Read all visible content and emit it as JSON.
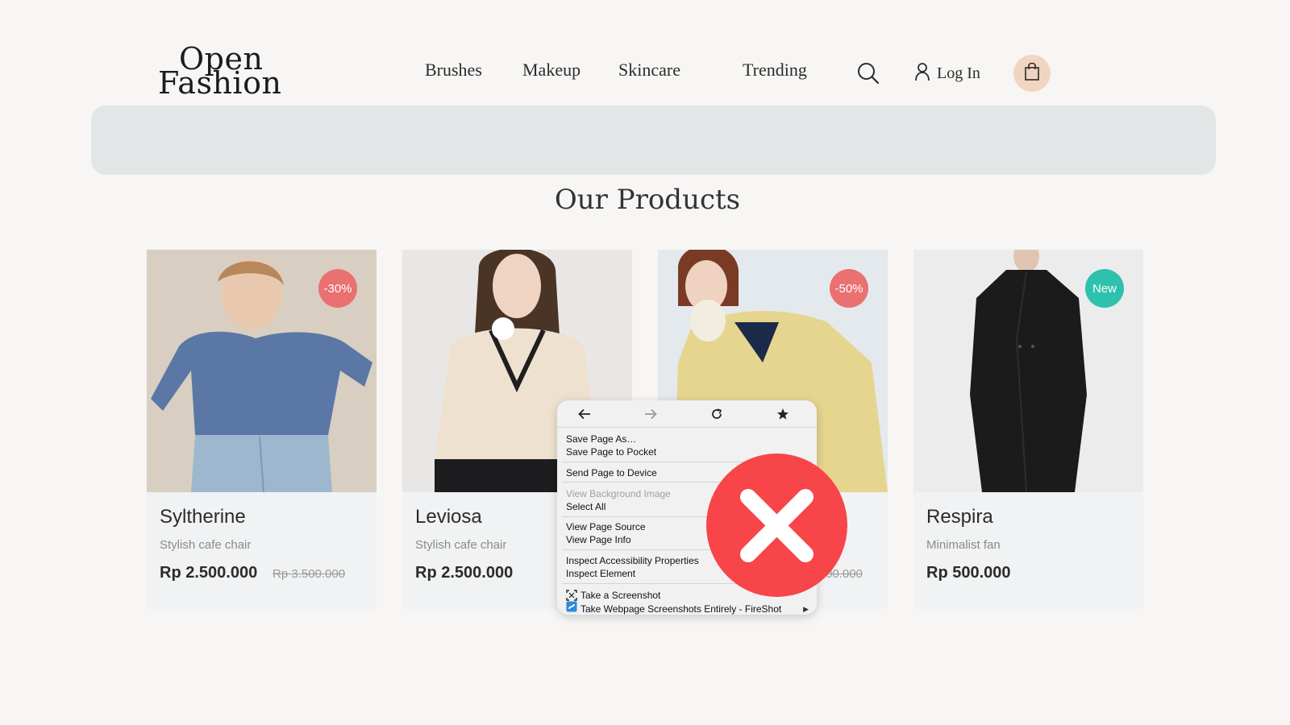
{
  "brand": {
    "line1": "Open",
    "line2": "Fashion"
  },
  "nav": [
    {
      "label": "Brushes"
    },
    {
      "label": "Makeup"
    },
    {
      "label": "Skincare"
    },
    {
      "label": "Trending"
    }
  ],
  "header": {
    "search_icon": "search-icon",
    "login_label": "Log In",
    "user_icon": "user-icon",
    "cart_icon": "shopping-bag-icon"
  },
  "section": {
    "title": "Our Products"
  },
  "products": [
    {
      "name": "Syltherine",
      "desc": "Stylish cafe chair",
      "price": "Rp 2.500.000",
      "old_price": "Rp 3.500.000",
      "badge": "-30%",
      "badge_color": "#e97171"
    },
    {
      "name": "Leviosa",
      "desc": "Stylish cafe chair",
      "price": "Rp 2.500.000",
      "old_price": "",
      "badge": "",
      "badge_color": ""
    },
    {
      "name": "",
      "desc": "",
      "price": "",
      "old_price": "00.000",
      "badge": "-50%",
      "badge_color": "#e97171"
    },
    {
      "name": "Respira",
      "desc": "Minimalist fan",
      "price": "Rp 500.000",
      "old_price": "",
      "badge": "New",
      "badge_color": "#2ec1ac"
    }
  ],
  "context_menu": {
    "toolbar": [
      "back-arrow-icon",
      "forward-arrow-icon",
      "reload-icon",
      "bookmark-star-icon"
    ],
    "items": {
      "save_as": "Save Page As…",
      "save_pocket": "Save Page to Pocket",
      "send_device": "Send Page to Device",
      "view_bg": "View Background Image",
      "select_all": "Select All",
      "view_source": "View Page Source",
      "view_info": "View Page Info",
      "inspect_a11y": "Inspect Accessibility Properties",
      "inspect_el": "Inspect Element",
      "screenshot": "Take a Screenshot",
      "fireshot": "Take Webpage Screenshots Entirely - FireShot"
    }
  },
  "overlay": {
    "icon": "error-x-icon",
    "color": "#f7454a"
  }
}
